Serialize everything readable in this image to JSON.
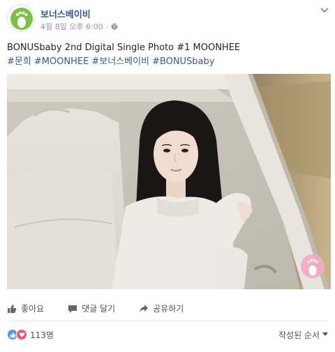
{
  "page": {
    "name": "보너스베이비",
    "timestamp": "4월 8일 오후 6:00",
    "separator": "·",
    "privacy_icon": "globe-icon",
    "options_icon": "chevron-down-icon",
    "avatar_icon": "footprint-logo",
    "accent": "#365899"
  },
  "post": {
    "caption": "BONUSbaby 2nd Digital Single Photo #1 MOONHEE",
    "hashtags": [
      "#문희",
      "#MOONHEE",
      "#보너스베이비",
      "#BONUSbaby"
    ]
  },
  "actions": {
    "like": "좋아요",
    "comment": "댓글 달기",
    "share": "공유하기"
  },
  "reactions": {
    "count": "113명",
    "sort": "작성된 순서"
  },
  "colors": {
    "like_blue": "#5890ff",
    "love_red": "#f25268",
    "watermark_pink": "#f5a9c4"
  }
}
